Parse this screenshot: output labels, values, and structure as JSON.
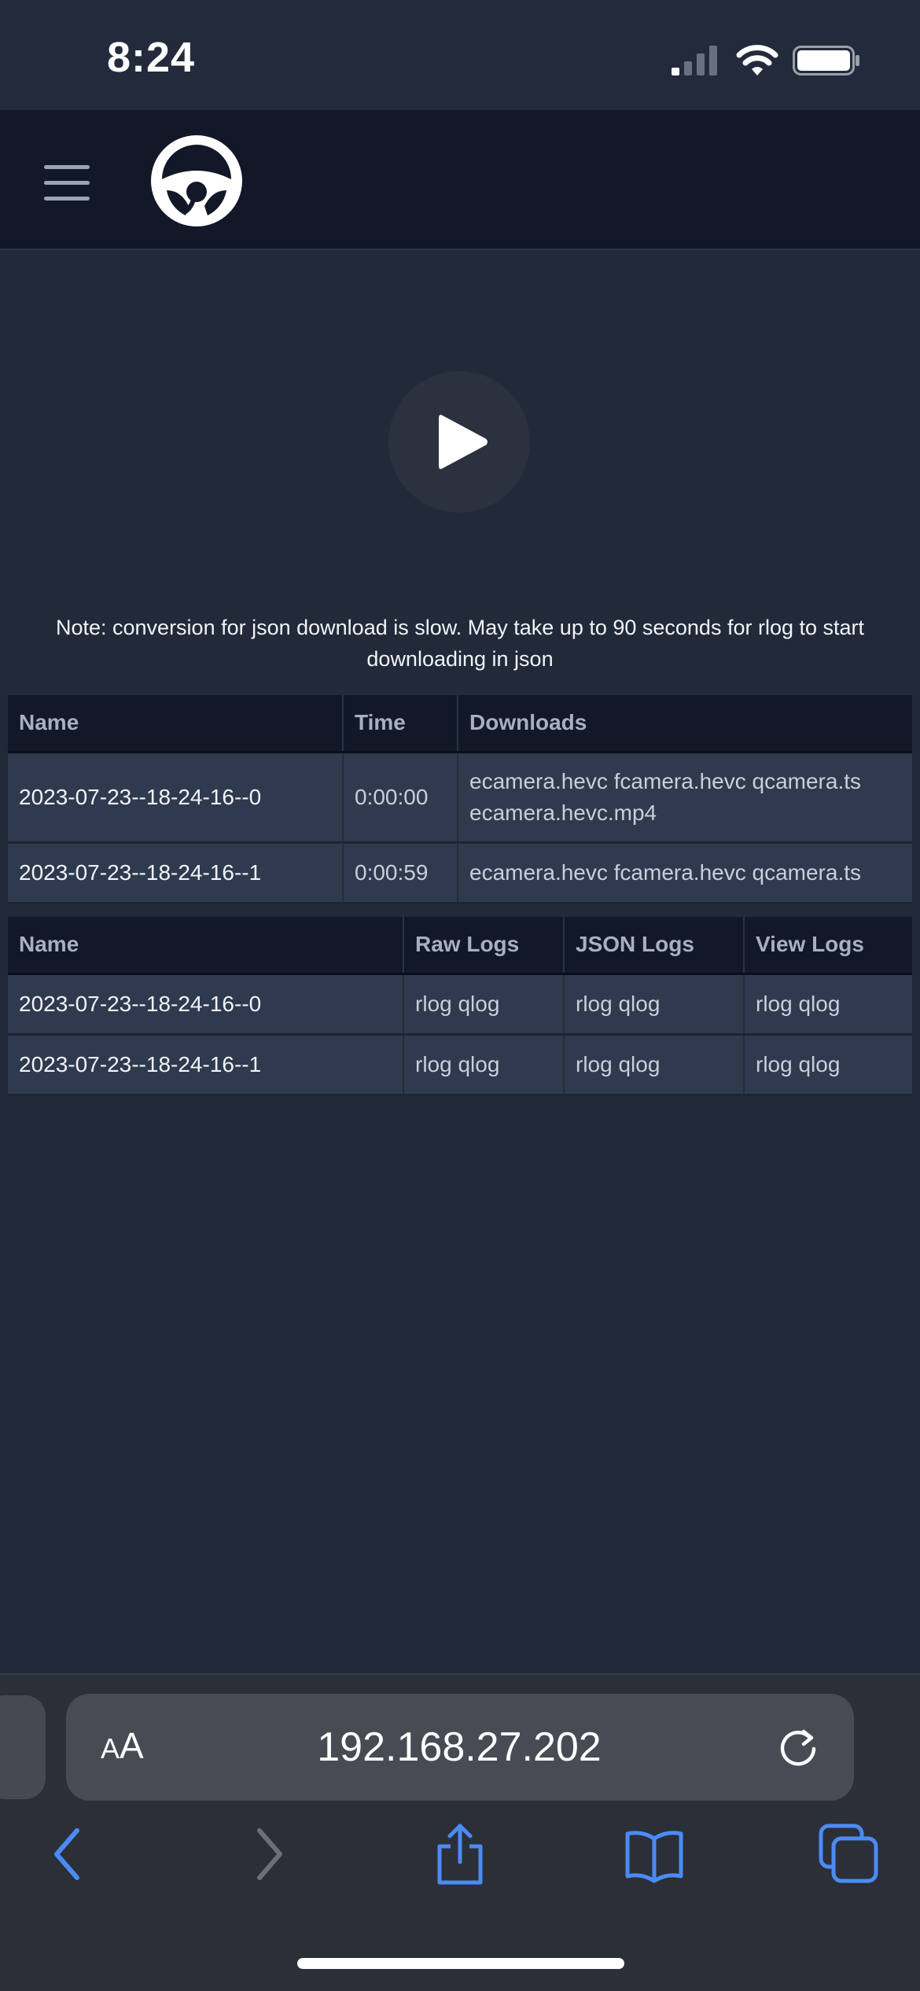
{
  "status_bar": {
    "time": "8:24"
  },
  "header": {
    "logo_icon": "steering-wheel-icon",
    "menu_icon": "hamburger-menu-icon"
  },
  "player": {
    "play_icon": "play-icon"
  },
  "note": "Note: conversion for json download is slow. May take up to 90 seconds for rlog to start downloading in json",
  "segments_table": {
    "columns": [
      "Name",
      "Time",
      "Downloads"
    ],
    "rows": [
      {
        "name": "2023-07-23--18-24-16--0",
        "time": "0:00:00",
        "downloads": [
          "ecamera.hevc",
          "fcamera.hevc",
          "qcamera.ts",
          "ecamera.hevc.mp4"
        ]
      },
      {
        "name": "2023-07-23--18-24-16--1",
        "time": "0:00:59",
        "downloads": [
          "ecamera.hevc",
          "fcamera.hevc",
          "qcamera.ts"
        ]
      }
    ]
  },
  "logs_table": {
    "columns": [
      "Name",
      "Raw Logs",
      "JSON Logs",
      "View Logs"
    ],
    "rows": [
      {
        "name": "2023-07-23--18-24-16--0",
        "raw": [
          "rlog",
          "qlog"
        ],
        "json": [
          "rlog",
          "qlog"
        ],
        "view": [
          "rlog",
          "qlog"
        ]
      },
      {
        "name": "2023-07-23--18-24-16--1",
        "raw": [
          "rlog",
          "qlog"
        ],
        "json": [
          "rlog",
          "qlog"
        ],
        "view": [
          "rlog",
          "qlog"
        ]
      }
    ]
  },
  "browser": {
    "text_size_label_small": "A",
    "text_size_label_large": "A",
    "url": "192.168.27.202",
    "icons": [
      "reload-icon",
      "back-icon",
      "forward-icon",
      "share-icon",
      "bookmarks-icon",
      "tabs-icon"
    ]
  },
  "colors": {
    "page_background": "#222939",
    "navbar_background": "#121827",
    "table_cell_background": "#2f3a4f",
    "table_header_background": "#121827",
    "accent_blue": "#4c8bf5"
  }
}
